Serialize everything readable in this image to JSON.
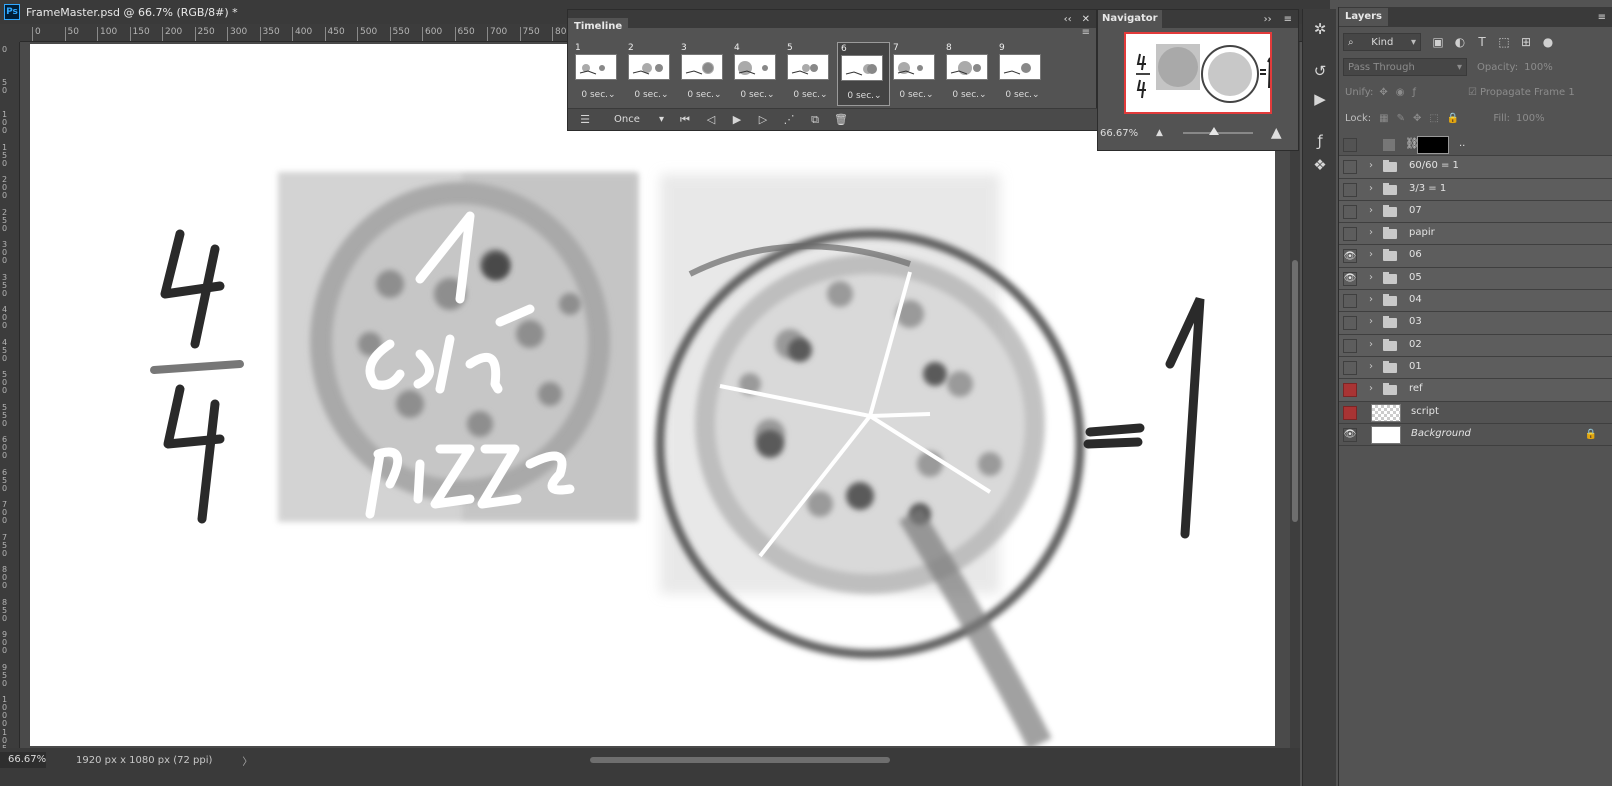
{
  "document": {
    "title": "FrameMaster.psd @ 66.7% (RGB/8#) *",
    "app_logo": "Ps"
  },
  "rulers": {
    "top": [
      "0",
      "50",
      "100",
      "150",
      "200",
      "250",
      "300",
      "350",
      "400",
      "450",
      "500",
      "550",
      "600",
      "650",
      "700",
      "750",
      "800"
    ],
    "left": [
      "0",
      "50",
      "100",
      "150",
      "200",
      "250",
      "300",
      "350",
      "400",
      "450",
      "500",
      "550",
      "600",
      "650",
      "700",
      "750",
      "800",
      "850",
      "900",
      "950",
      "1000",
      "1050"
    ]
  },
  "status": {
    "zoom": "66.67%",
    "doc_size": "1920 px x 1080 px (72 ppi)",
    "arrow": "〉"
  },
  "timeline": {
    "tab": "Timeline",
    "collapse": "‹‹",
    "close": "✕",
    "menu": "≡",
    "frames": [
      {
        "num": "1",
        "delay": "0 sec.⌄"
      },
      {
        "num": "2",
        "delay": "0 sec.⌄"
      },
      {
        "num": "3",
        "delay": "0 sec.⌄"
      },
      {
        "num": "4",
        "delay": "0 sec.⌄"
      },
      {
        "num": "5",
        "delay": "0 sec.⌄"
      },
      {
        "num": "6",
        "delay": "0 sec.⌄"
      },
      {
        "num": "7",
        "delay": "0 sec.⌄"
      },
      {
        "num": "8",
        "delay": "0 sec.⌄"
      },
      {
        "num": "9",
        "delay": "0 sec.⌄"
      }
    ],
    "selected_frame": 6,
    "loop": "Once"
  },
  "navigator": {
    "tab": "Navigator",
    "expand": "››",
    "menu": "≡",
    "zoom": "66.67%"
  },
  "layers": {
    "tab": "Layers",
    "menu": "≡",
    "filter_kind": "Kind",
    "blend_mode": "Pass Through",
    "opacity_label": "Opacity:",
    "opacity_value": "100%",
    "unify_label": "Unify:",
    "propagate_label": "Propagate Frame 1",
    "lock_label": "Lock:",
    "fill_label": "Fill:",
    "fill_value": "100%",
    "rows": [
      {
        "name": "..",
        "type": "adjust",
        "visible": false,
        "red": false
      },
      {
        "name": "60/60 = 1",
        "type": "group",
        "visible": false,
        "red": false
      },
      {
        "name": "3/3 = 1",
        "type": "group",
        "visible": false,
        "red": false
      },
      {
        "name": "07",
        "type": "group",
        "visible": false,
        "red": false
      },
      {
        "name": "papir",
        "type": "group",
        "visible": false,
        "red": false
      },
      {
        "name": "06",
        "type": "group",
        "visible": true,
        "red": false
      },
      {
        "name": "05",
        "type": "group",
        "visible": true,
        "red": false
      },
      {
        "name": "04",
        "type": "group",
        "visible": false,
        "red": false
      },
      {
        "name": "03",
        "type": "group",
        "visible": false,
        "red": false
      },
      {
        "name": "02",
        "type": "group",
        "visible": false,
        "red": false
      },
      {
        "name": "01",
        "type": "group",
        "visible": false,
        "red": false
      },
      {
        "name": "ref",
        "type": "group",
        "visible": false,
        "red": true
      },
      {
        "name": "script",
        "type": "checker",
        "visible": false,
        "red": true
      },
      {
        "name": "Background",
        "type": "background",
        "visible": true,
        "red": false
      }
    ]
  },
  "canvas_art": {
    "fraction_top": "4",
    "fraction_bottom": "4",
    "equals": "=",
    "result": "1",
    "pizza_note": [
      "1-",
      "cela",
      "pizza"
    ]
  },
  "colors": {
    "panel": "#535353",
    "dark": "#3a3a3a",
    "highlight_red": "#e23b3b",
    "layer_red": "#a83434"
  }
}
